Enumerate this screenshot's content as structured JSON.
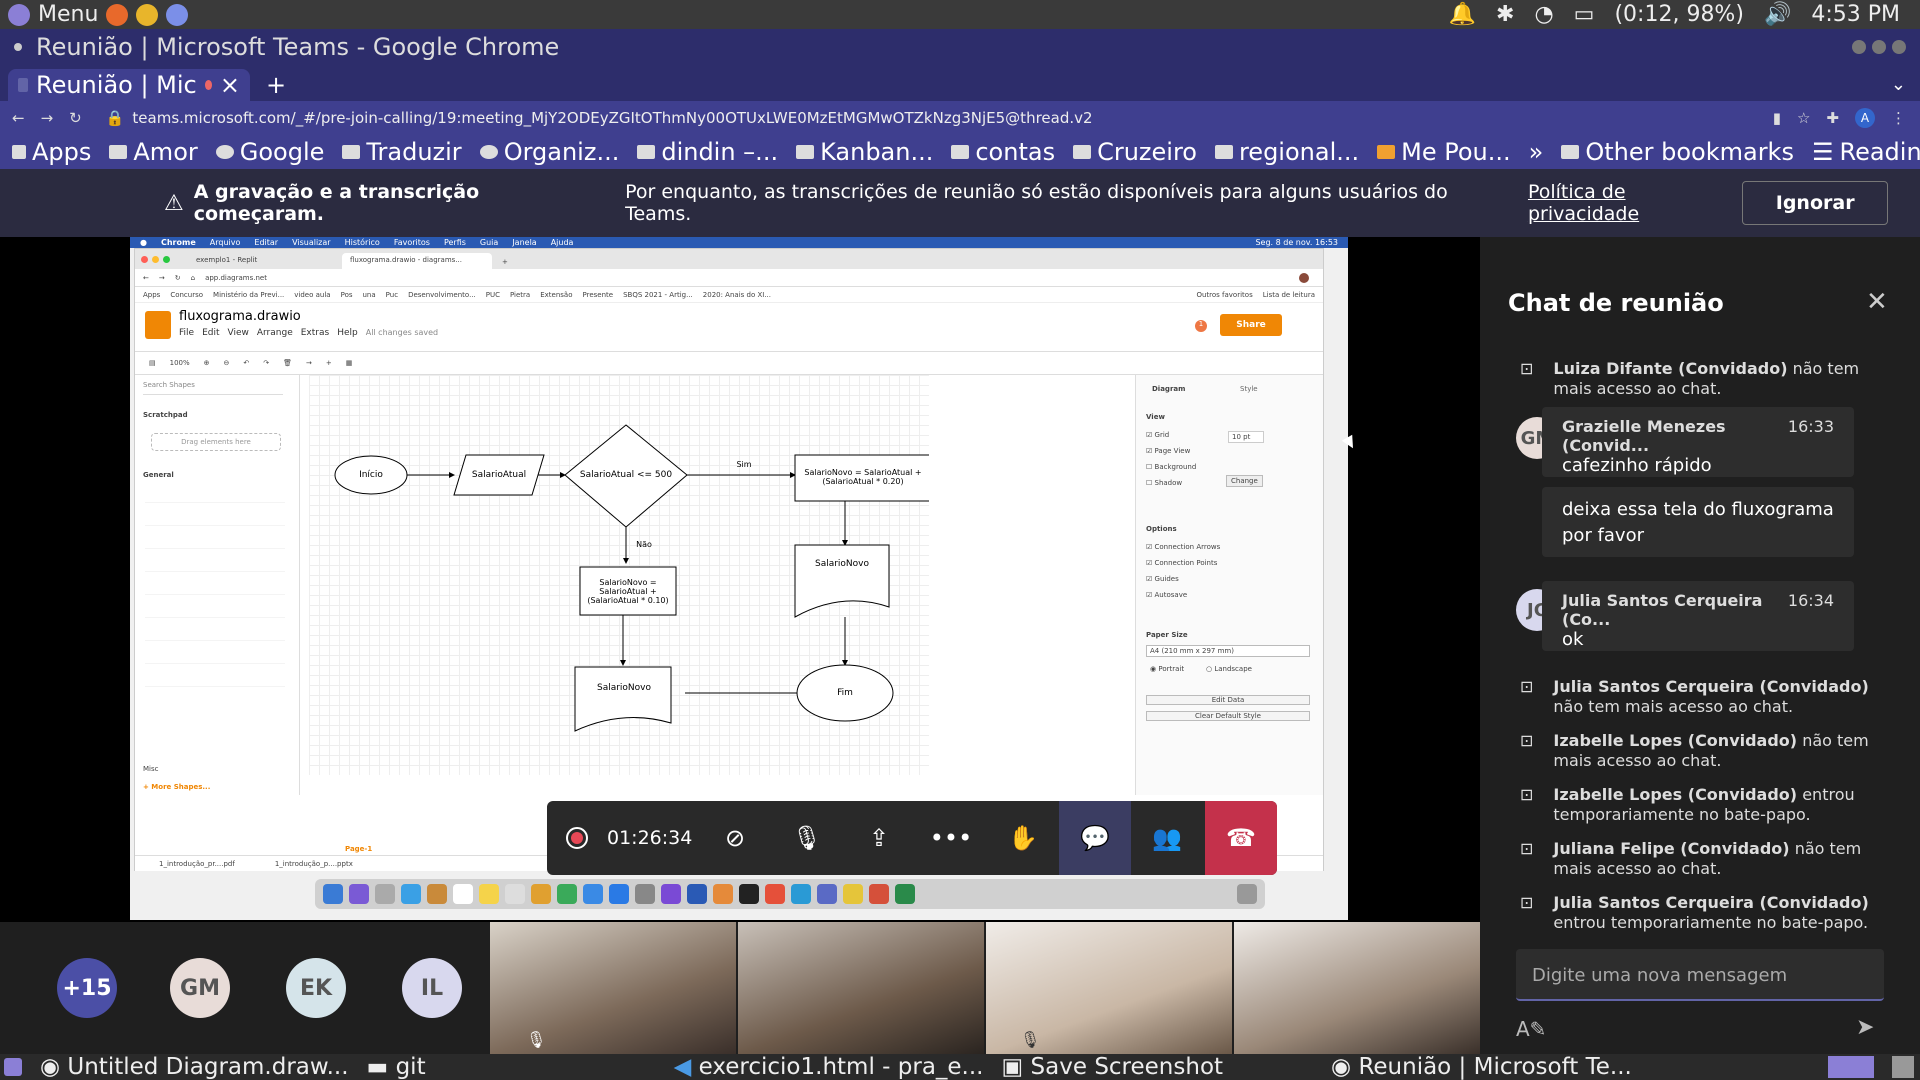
{
  "system_bar": {
    "menu_label": "Menu",
    "battery": "(0:12, 98%)",
    "clock": "4:53 PM"
  },
  "chrome": {
    "window_title": "Reunião | Microsoft Teams - Google Chrome",
    "tab_title": "Reunião | Mic",
    "url": "teams.microsoft.com/_#/pre-join-calling/19:meeting_MjY2ODEyZGItOThmNy00OTUxLWE0MzEtMGMwOTZkNzg3NjE5@thread.v2",
    "bookmarks": [
      "Apps",
      "Amor",
      "Google",
      "Traduzir",
      "Organiz...",
      "dindin –...",
      "Kanban...",
      "contas",
      "Cruzeiro",
      "regional...",
      "Me Pou..."
    ],
    "bookmarks_overflow": "»",
    "other_bookmarks": "Other bookmarks",
    "reading_list": "Reading list"
  },
  "banner": {
    "bold": "A gravação e a transcrição começaram.",
    "text": "Por enquanto, as transcrições de reunião só estão disponíveis para alguns usuários do Teams.",
    "link": "Política de privacidade",
    "dismiss": "Ignorar"
  },
  "shared": {
    "mac_menu": [
      "Chrome",
      "Arquivo",
      "Editar",
      "Visualizar",
      "Histórico",
      "Favoritos",
      "Perfis",
      "Guia",
      "Janela",
      "Ajuda"
    ],
    "mac_clock": "Seg. 8 de nov. 16:53",
    "tabs": [
      "exemplo1 - Replit",
      "fluxograma.drawio - diagrams..."
    ],
    "url": "app.diagrams.net",
    "bookmarks": [
      "Apps",
      "Concurso",
      "Ministério da Previ...",
      "video aula",
      "Pos",
      "una",
      "Puc",
      "Desenvolvimento...",
      "PUC",
      "Pietra",
      "Extensão",
      "Presente",
      "SBQS 2021 - Artig...",
      "2020: Anais do XI..."
    ],
    "bookmarks_right": [
      "Outros favoritos",
      "Lista de leitura"
    ],
    "file_name": "fluxograma.drawio",
    "menu": [
      "File",
      "Edit",
      "View",
      "Arrange",
      "Extras",
      "Help"
    ],
    "saved": "All changes saved",
    "share": "Share",
    "zoom": "100%",
    "search_shapes": "Search Shapes",
    "scratchpad": "Scratchpad",
    "drag_here": "Drag elements here",
    "general": "General",
    "misc": "Misc",
    "more_shapes": "+ More Shapes...",
    "page_tab": "Page-1",
    "panel_tabs": [
      "Diagram",
      "Style"
    ],
    "view_title": "View",
    "view_opts": [
      "Grid",
      "Page View",
      "Background",
      "Shadow"
    ],
    "grid_size": "10 pt",
    "change": "Change",
    "options_title": "Options",
    "options": [
      "Connection Arrows",
      "Connection Points",
      "Guides",
      "Autosave"
    ],
    "paper_title": "Paper Size",
    "paper": "A4 (210 mm x 297 mm)",
    "portrait": "Portrait",
    "landscape": "Landscape",
    "edit_data": "Edit Data",
    "clear_style": "Clear Default Style",
    "downloads": [
      "1_introdução_pr....pdf",
      "1_introdução_p....pptx"
    ],
    "nodes": {
      "inicio": "Início",
      "salario_atual": "SalarioAtual",
      "decision": "SalarioAtual <= 500",
      "sim": "Sim",
      "nao": "Não",
      "novo_020": "SalarioNovo = SalarioAtual + (SalarioAtual * 0.20)",
      "novo_010": "SalarioNovo = SalarioAtual + (SalarioAtual * 0.10)",
      "doc_right": "SalarioNovo",
      "doc_left": "SalarioNovo",
      "fim": "Fim"
    }
  },
  "call": {
    "timer": "01:26:34"
  },
  "chat": {
    "title": "Chat de reunião",
    "messages": [
      {
        "name": "Luiza Difante (Convidado)",
        "text": "não tem mais acesso ao chat."
      },
      {
        "initials": "GM",
        "name": "Grazielle Menezes (Convid...",
        "time": "16:33",
        "text": "cafezinho rápido"
      },
      {
        "text": "deixa essa tela do fluxograma por favor"
      },
      {
        "initials": "JC",
        "name": "Julia Santos Cerqueira (Co...",
        "time": "16:34",
        "text": "ok"
      },
      {
        "name": "Julia Santos Cerqueira (Convidado)",
        "text": "não tem mais acesso ao chat."
      },
      {
        "name": "Izabelle Lopes (Convidado)",
        "text": "não tem mais acesso ao chat."
      },
      {
        "name": "Izabelle Lopes (Convidado)",
        "text": "entrou temporariamente no bate-papo."
      },
      {
        "name": "Juliana Felipe (Convidado)",
        "text": "não tem mais acesso ao chat."
      },
      {
        "name": "Julia Santos Cerqueira (Convidado)",
        "text": "entrou temporariamente no bate-papo."
      }
    ],
    "placeholder": "Digite uma nova mensagem"
  },
  "participants": {
    "more": "+15",
    "avatars": [
      "GM",
      "EK",
      "IL"
    ]
  },
  "taskbar": {
    "items": [
      "Untitled Diagram.draw...",
      "git",
      "exercicio1.html - pra_e...",
      "Save Screenshot",
      "Reunião | Microsoft Te..."
    ]
  },
  "colors": {
    "teams_purple": "#6264a7",
    "hangup": "#c4314b",
    "drawio_orange": "#f08705"
  }
}
